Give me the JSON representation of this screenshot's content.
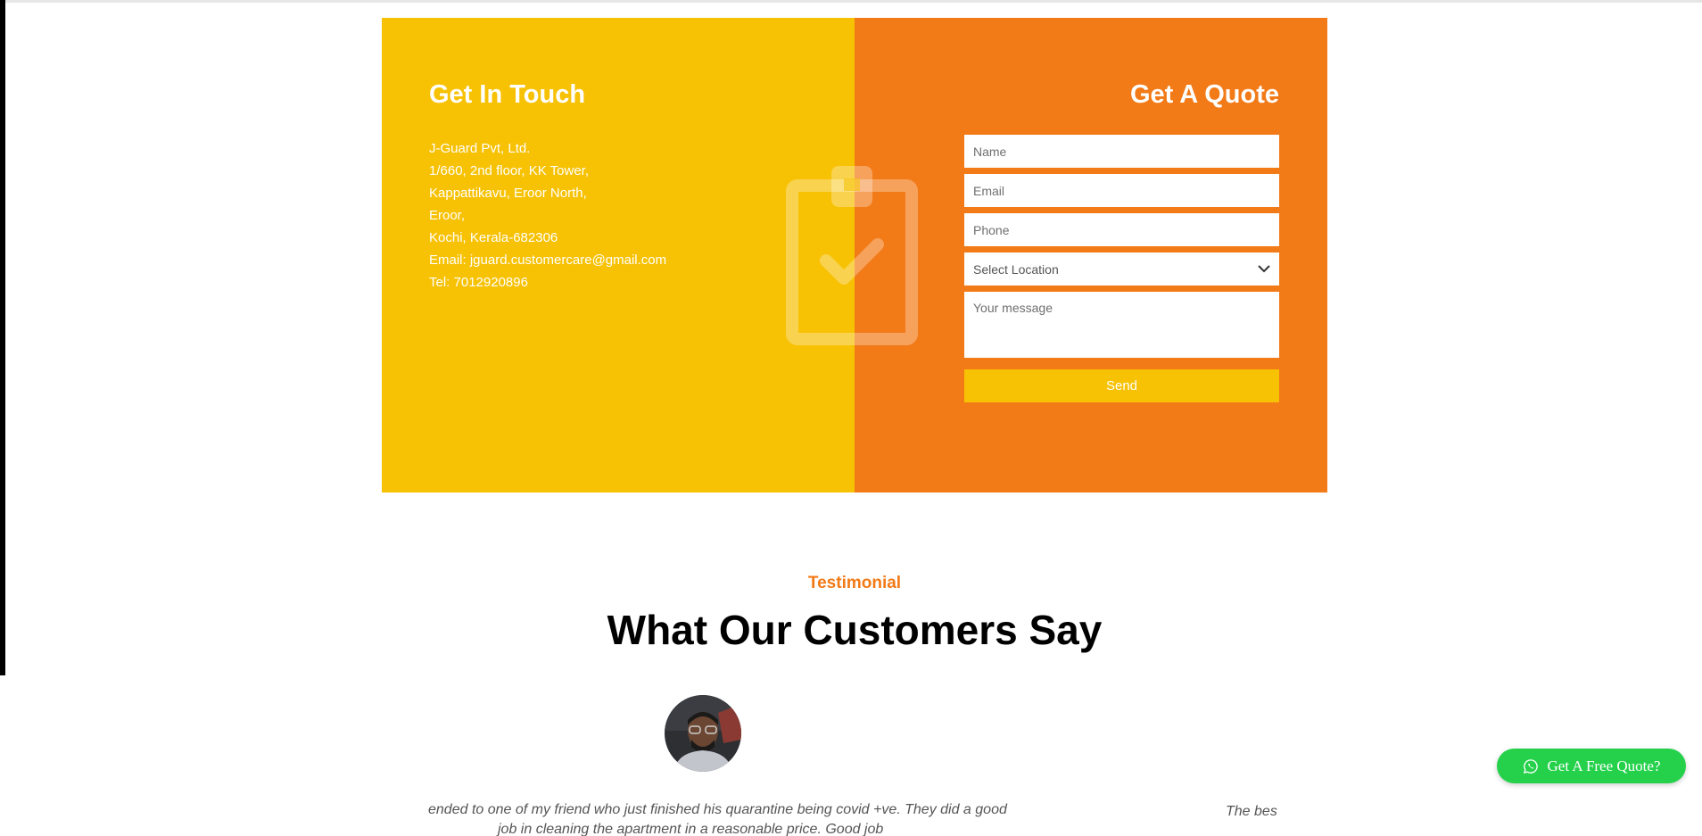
{
  "contact": {
    "left": {
      "title": "Get In Touch",
      "address_lines": [
        "J-Guard Pvt, Ltd.",
        "1/660, 2nd floor, KK Tower,",
        "Kappattikavu, Eroor North,",
        "Eroor,",
        "Kochi, Kerala-682306",
        "Email: jguard.customercare@gmail.com",
        "Tel: 7012920896"
      ],
      "decor_icon": "clipboard-check-icon",
      "bg_color": "#f7c104"
    },
    "right": {
      "title": "Get A Quote",
      "bg_color": "#f27a17",
      "form": {
        "name_placeholder": "Name",
        "email_placeholder": "Email",
        "phone_placeholder": "Phone",
        "location_selected": "Select Location",
        "message_placeholder": "Your message",
        "send_label": "Send"
      }
    }
  },
  "testimonial": {
    "tag": "Testimonial",
    "title": "What Our Customers Say",
    "quote_line1": "ended to one of my friend who just finished his quarantine being covid +ve. They did a good",
    "quote_line2": "job in cleaning the apartment in a reasonable price. Good job",
    "next_quote_start": "The bes"
  },
  "floating": {
    "whatsapp_label": "Get A Free Quote?",
    "icon": "whatsapp-icon",
    "color": "#25d14b"
  }
}
